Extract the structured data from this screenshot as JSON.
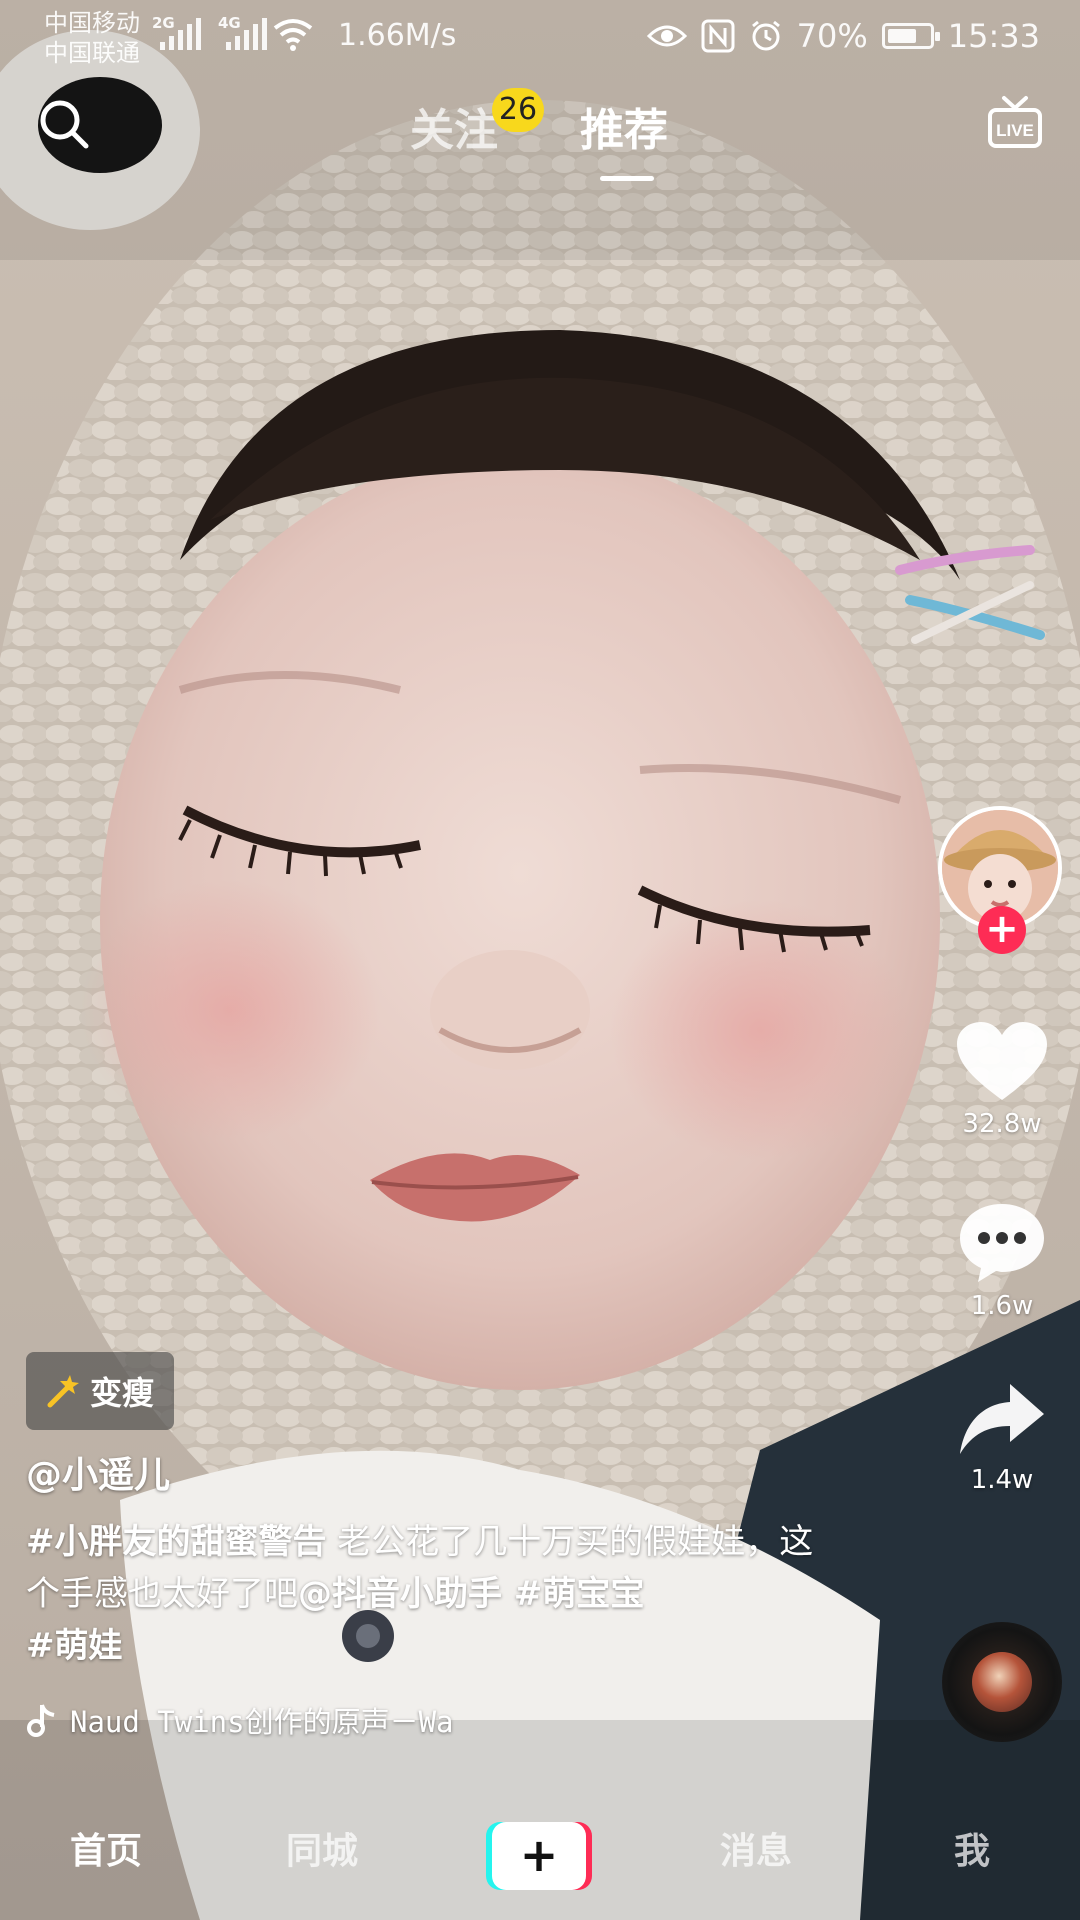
{
  "status_bar": {
    "carrier_1": "中国移动",
    "carrier_2": "中国联通",
    "network_1": "2G",
    "network_2": "4G",
    "net_speed": "1.66M/s",
    "battery_percent": "70%",
    "battery_level": 0.7,
    "time": "15:33"
  },
  "top_nav": {
    "follow_tab": "关注",
    "follow_badge": "26",
    "recommend_tab": "推荐",
    "active_tab": "推荐",
    "live_label": "LIVE"
  },
  "right_rail": {
    "like_count": "32.8w",
    "comment_count": "1.6w",
    "share_count": "1.4w"
  },
  "video_info": {
    "effect_tag": "变瘦",
    "username": "@小遥儿",
    "caption_hashtag_1": "#小胖友的甜蜜警告",
    "caption_text_1": " 老公花了几十万买的假娃娃，这个手感也太好了吧",
    "caption_mention": "@抖音小助手",
    "caption_hashtag_2": " #萌宝宝",
    "caption_hashtag_3": "#萌娃",
    "music": "Naud Twins创作的原声－Wa"
  },
  "bottom_nav": {
    "home": "首页",
    "city": "同城",
    "publish": "+",
    "messages": "消息",
    "me": "我"
  },
  "icons": {
    "search": "search-icon",
    "live": "live-icon",
    "like": "heart-icon",
    "comment": "comment-icon",
    "share": "share-icon",
    "music": "music-note-icon",
    "effect": "magic-wand-icon"
  },
  "colors": {
    "accent_red": "#fe2c55",
    "accent_cyan": "#25f4ee",
    "badge_yellow": "#f8d81c"
  }
}
